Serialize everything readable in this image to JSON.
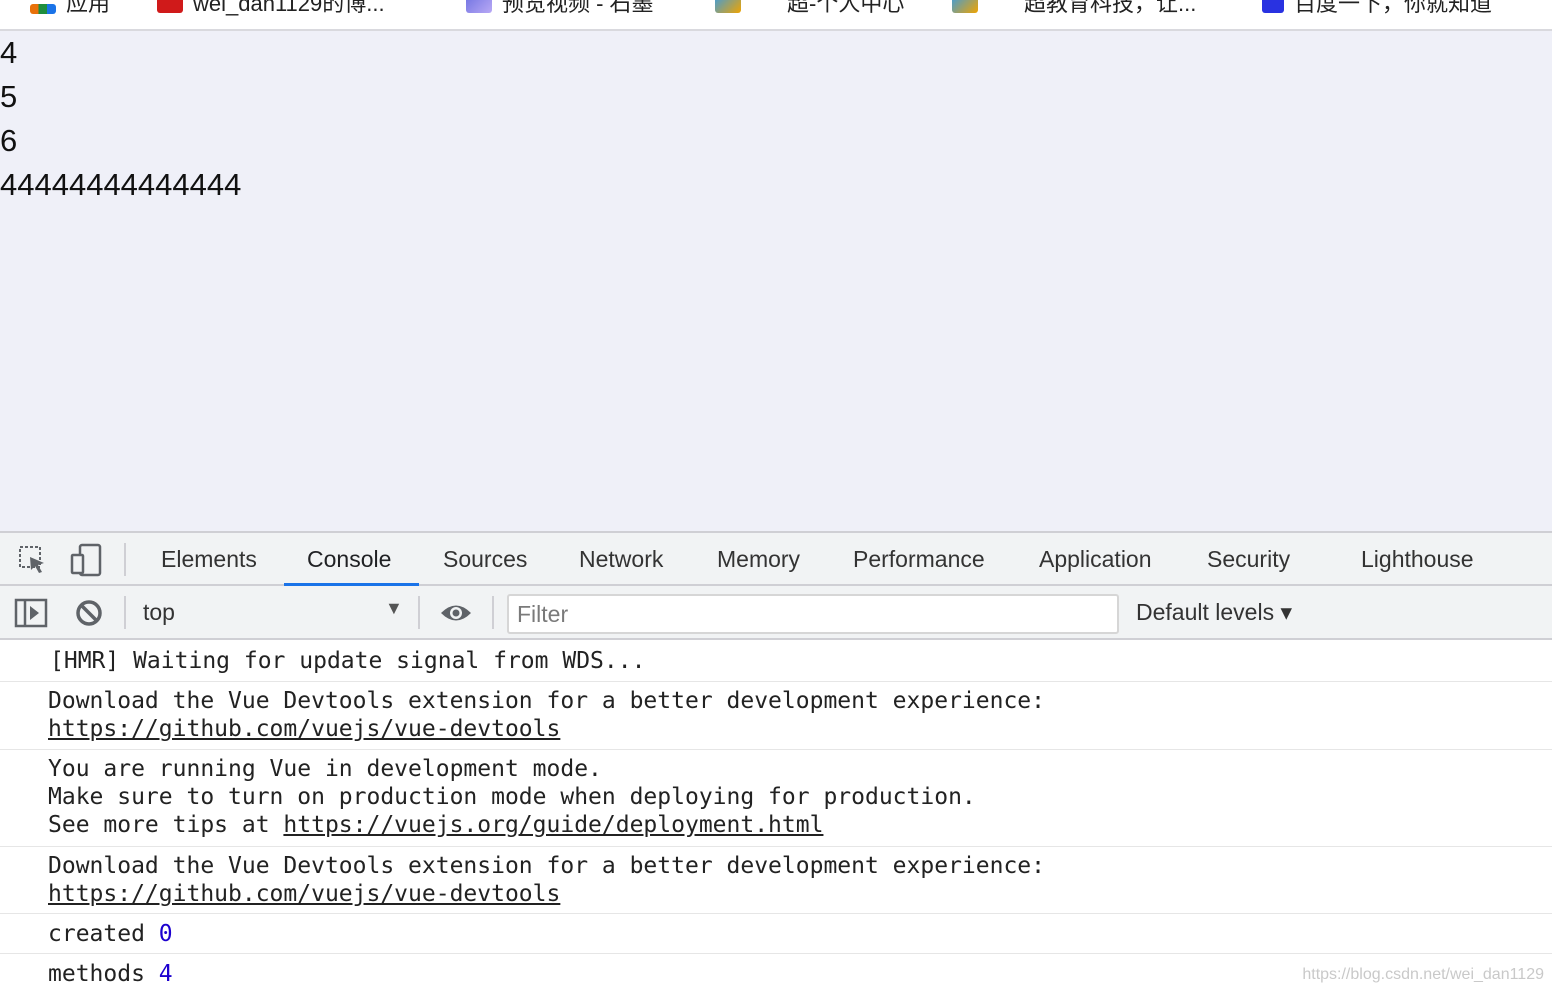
{
  "bookmarks": [
    {
      "label": "应用",
      "icon": "apps-grid-icon",
      "color": "#e8710a"
    },
    {
      "label": "wei_dan1129的博...",
      "icon": "csdn-icon",
      "color": "#d01a1a"
    },
    {
      "label": "预览视频 - 石墨",
      "icon": "play-icon",
      "color": "#6a6ee0"
    },
    {
      "label": "超-个人中心",
      "icon": "feather-icon",
      "color": "#f0a400"
    },
    {
      "label": "超教育科技，让...",
      "icon": "feather-icon",
      "color": "#f0a400"
    },
    {
      "label": "百度一下，你就知道",
      "icon": "baidu-icon",
      "color": "#2932e1"
    }
  ],
  "page": {
    "lines": [
      "4",
      "5",
      "6",
      "44444444444444"
    ]
  },
  "devtools": {
    "tabs": [
      "Elements",
      "Console",
      "Sources",
      "Network",
      "Memory",
      "Performance",
      "Application",
      "Security",
      "Lighthouse"
    ],
    "active_tab": "Console",
    "context": "top",
    "filter_placeholder": "Filter",
    "levels_label": "Default levels ▾",
    "accent_color": "#1a73e8"
  },
  "console": {
    "messages": [
      {
        "lines": [
          "[HMR] Waiting for update signal from WDS..."
        ]
      },
      {
        "lines": [
          "Download the Vue Devtools extension for a better development experience:"
        ],
        "link": "https://github.com/vuejs/vue-devtools"
      },
      {
        "lines": [
          "You are running Vue in development mode.",
          "Make sure to turn on production mode when deploying for production."
        ],
        "prefix": "See more tips at ",
        "link": "https://vuejs.org/guide/deployment.html"
      },
      {
        "lines": [
          "Download the Vue Devtools extension for a better development experience:"
        ],
        "link": "https://github.com/vuejs/vue-devtools"
      },
      {
        "label": "created",
        "value": "0"
      },
      {
        "label": "methods",
        "value": "4"
      }
    ]
  },
  "watermark": "https://blog.csdn.net/wei_dan1129"
}
